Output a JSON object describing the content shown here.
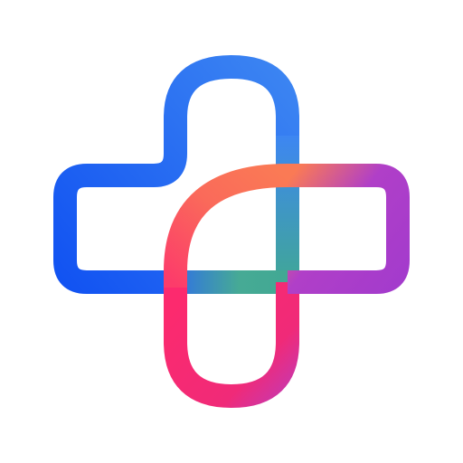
{
  "logo": {
    "icon": "medical-cross-logo-icon",
    "background_color": "#ffffff",
    "colors": {
      "blue_start": "#1253f2",
      "blue_light": "#3d86f2",
      "teal": "#41a893",
      "orange": "#fa7a55",
      "purple": "#a43bcc",
      "pink": "#fc2a6e"
    }
  }
}
